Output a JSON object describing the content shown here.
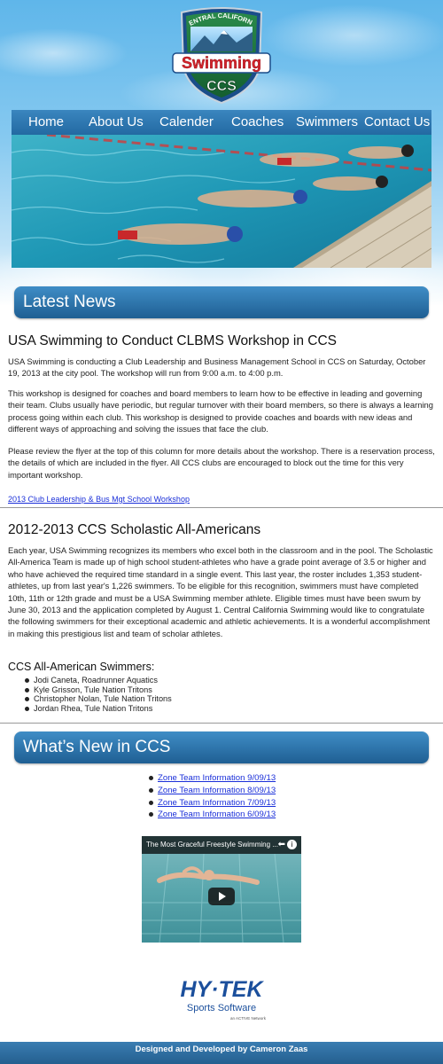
{
  "logo": {
    "top_text": "CENTRAL CALIFORNIA",
    "main_text": "Swimming",
    "sub_text": "CCS"
  },
  "nav": {
    "items": [
      "Home",
      "About Us",
      "Calender",
      "Coaches",
      "Swimmers",
      "Contact Us"
    ]
  },
  "latest_news": {
    "heading": "Latest News",
    "article1": {
      "title": "USA Swimming to Conduct CLBMS Workshop in CCS",
      "p1": "USA Swimming is conducting a Club Leadership and Business Management School in CCS on Saturday, October 19, 2013 at the city pool. The workshop will run from 9:00 a.m. to 4:00 p.m.",
      "p2": "This workshop is designed for coaches and board members to learn how to be effective in leading and governing their team. Clubs usually have periodic, but regular turnover with their board members, so there is always a learning process going within each club. This workshop is designed to provide coaches and boards with new ideas and different ways of approaching and solving the issues that face the club.",
      "p3": "Please review the flyer at the top of this column for more details about the workshop. There is a reservation process, the details of which are included in the flyer. All CCS clubs are encouraged to block out the time for this very important workshop.",
      "link": "2013 Club Leadership & Bus Mgt School Workshop"
    },
    "article2": {
      "title": "2012-2013 CCS Scholastic All-Americans",
      "p1": "Each year, USA Swimming recognizes its members who excel both in the classroom and in the pool. The Scholastic All-America Team is made up of high school student-athletes who have a grade point average of 3.5 or higher and who have achieved the required time standard in a single event. This last year, the roster includes 1,353 student-athletes, up from last year's 1,226 swimmers. To be eligible for this recognition, swimmers must have completed 10th, 11th or 12th grade and must be a USA Swimming member athlete. Eligible times must have been swum by June 30, 2013 and the application completed by August 1. Central California Swimming would like to congratulate the following swimmers for their exceptional academic and athletic achievements. It is a wonderful accomplishment in making this prestigious list and team of scholar athletes.",
      "swimmers_title": "CCS All-American Swimmers:",
      "swimmers": [
        "Jodi Caneta, Roadrunner Aquatics",
        "Kyle Grisson, Tule Nation Tritons",
        "Christopher Nolan, Tule Nation Tritons",
        "Jordan Rhea, Tule Nation Tritons"
      ]
    }
  },
  "whats_new": {
    "heading": "What’s New in CCS",
    "links": [
      "Zone Team Information 9/09/13",
      "Zone Team Information 8/09/13",
      "Zone Team Information 7/09/13",
      "Zone Team Information 6/09/13"
    ],
    "video_title": "The Most Graceful Freestyle Swimming ..."
  },
  "hytek": {
    "brand": "HY·TEK",
    "tagline": "Sports Software",
    "small": "an ACTIVE Network"
  },
  "footer": {
    "text": "Designed and Developed by Cameron Zaas"
  },
  "colors": {
    "nav_blue": "#236aa2",
    "banner_blue": "#2a73ad",
    "logo_red": "#d3232b",
    "logo_green": "#1c7a3c",
    "link_blue": "#1a2fd9"
  }
}
